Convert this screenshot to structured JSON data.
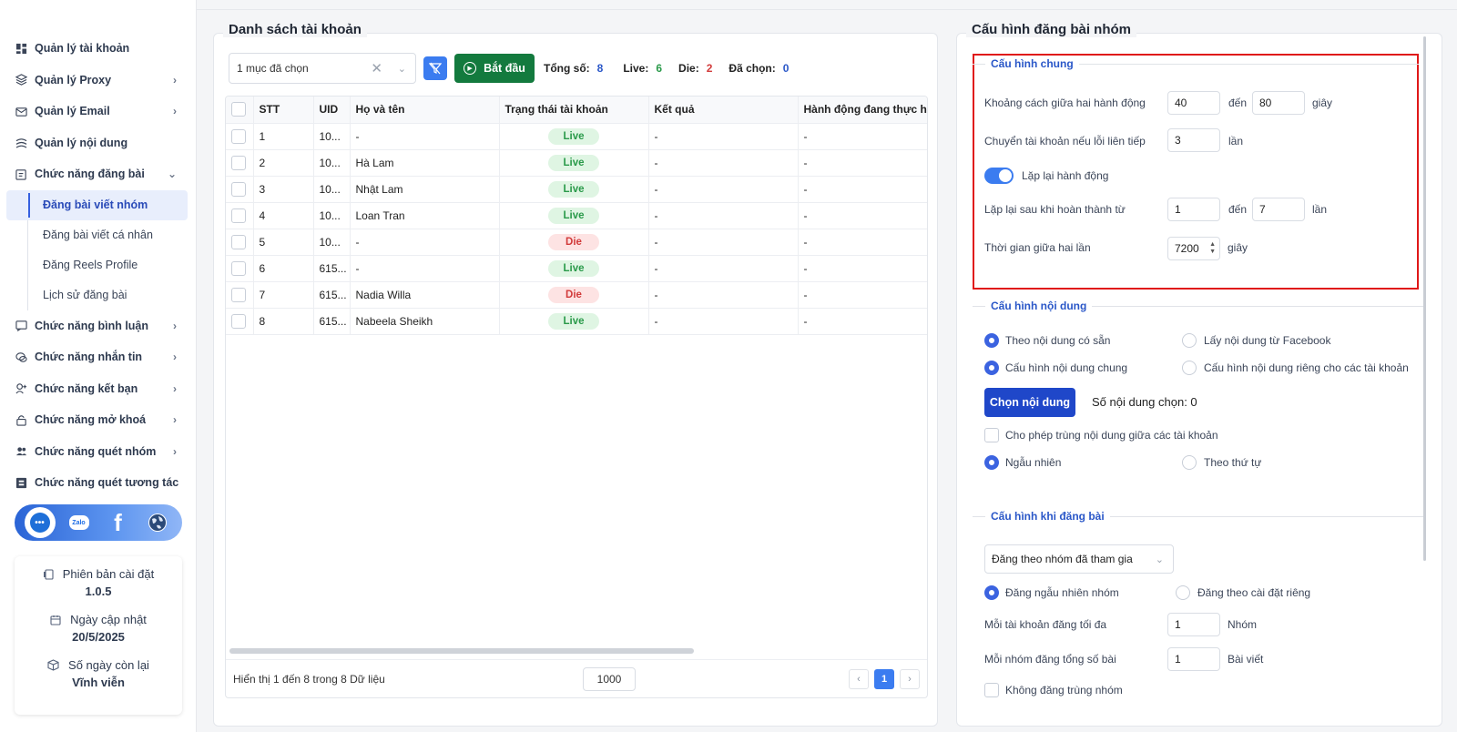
{
  "sidebar": {
    "items": [
      {
        "label": "Quản lý tài khoản",
        "icon": "dashboard-icon",
        "chevron": ""
      },
      {
        "label": "Quản lý Proxy",
        "icon": "layers-icon",
        "chevron": "›"
      },
      {
        "label": "Quản lý Email",
        "icon": "mail-icon",
        "chevron": "›"
      },
      {
        "label": "Quản lý nội dung",
        "icon": "content-icon",
        "chevron": ""
      },
      {
        "label": "Chức năng đăng bài",
        "icon": "post-icon",
        "chevron": "⌄"
      }
    ],
    "sub_items": [
      {
        "label": "Đăng bài viết nhóm",
        "active": true
      },
      {
        "label": "Đăng bài viết cá nhân",
        "active": false
      },
      {
        "label": "Đăng Reels Profile",
        "active": false
      },
      {
        "label": "Lịch sử đăng bài",
        "active": false
      }
    ],
    "items2": [
      {
        "label": "Chức năng bình luận",
        "icon": "comment-icon",
        "chevron": "›"
      },
      {
        "label": "Chức năng nhắn tin",
        "icon": "chat-icon",
        "chevron": "›"
      },
      {
        "label": "Chức năng kết bạn",
        "icon": "add-friend-icon",
        "chevron": "›"
      },
      {
        "label": "Chức năng mở khoá",
        "icon": "lock-icon",
        "chevron": "›"
      },
      {
        "label": "Chức năng quét nhóm",
        "icon": "group-icon",
        "chevron": "›"
      },
      {
        "label": "Chức năng quét tương tác",
        "icon": "scan-icon",
        "chevron": ""
      }
    ],
    "social": {
      "zalo": "Zalo",
      "facebook": "f"
    },
    "info": {
      "version_label": "Phiên bản cài đặt",
      "version": "1.0.5",
      "updated_label": "Ngày cập nhật",
      "updated": "20/5/2025",
      "days_label": "Số ngày còn lại",
      "days": "Vĩnh viễn"
    }
  },
  "left": {
    "title": "Danh sách tài khoản",
    "select_value": "1 mục đã chọn",
    "start_label": "Bắt đầu",
    "stats": {
      "total_label": "Tổng số:",
      "total": "8",
      "live_label": "Live:",
      "live": "6",
      "die_label": "Die:",
      "die": "2",
      "selected_label": "Đã chọn:",
      "selected": "0"
    },
    "colors": {
      "total": "#2a57c8",
      "live": "#2a9a4a",
      "die": "#d23b3b",
      "selected": "#2a57c8"
    },
    "columns": [
      "STT",
      "UID",
      "Họ và tên",
      "Trạng thái tài khoản",
      "Kết quả",
      "Hành động đang thực hiện"
    ],
    "rows": [
      {
        "stt": "1",
        "uid": "10...",
        "name": "-",
        "status": "Live",
        "result": "-",
        "action": "-"
      },
      {
        "stt": "2",
        "uid": "10...",
        "name": "Hà Lam",
        "status": "Live",
        "result": "-",
        "action": "-"
      },
      {
        "stt": "3",
        "uid": "10...",
        "name": "Nhật Lam",
        "status": "Live",
        "result": "-",
        "action": "-"
      },
      {
        "stt": "4",
        "uid": "10...",
        "name": "Loan Tran",
        "status": "Live",
        "result": "-",
        "action": "-"
      },
      {
        "stt": "5",
        "uid": "10...",
        "name": "-",
        "status": "Die",
        "result": "-",
        "action": "-"
      },
      {
        "stt": "6",
        "uid": "615...",
        "name": "-",
        "status": "Live",
        "result": "-",
        "action": "-"
      },
      {
        "stt": "7",
        "uid": "615...",
        "name": "Nadia Willa",
        "status": "Die",
        "result": "-",
        "action": "-"
      },
      {
        "stt": "8",
        "uid": "615...",
        "name": "Nabeela Sheikh",
        "status": "Live",
        "result": "-",
        "action": "-"
      }
    ],
    "footer_text": "Hiển thị 1 đến 8 trong 8 Dữ liệu",
    "page_size": "1000",
    "page_prev": "‹",
    "page_current": "1",
    "page_next": "›"
  },
  "right": {
    "title": "Cấu hình đăng bài nhóm",
    "general": {
      "title": "Cấu hình chung",
      "delay_label": "Khoảng cách giữa hai hành động",
      "delay_from": "40",
      "to_label": "đến",
      "delay_to": "80",
      "delay_unit": "giây",
      "switch_label": "Chuyển tài khoản nếu lỗi liên tiếp",
      "switch_value": "3",
      "switch_unit": "lần",
      "repeat_toggle_label": "Lặp lại hành động",
      "repeat_after_label": "Lặp lại sau khi hoàn thành từ",
      "repeat_from": "1",
      "repeat_to_label": "đến",
      "repeat_to": "7",
      "repeat_unit": "lần",
      "interval_label": "Thời gian giữa hai lần",
      "interval_value": "7200",
      "interval_unit": "giây"
    },
    "content": {
      "title": "Cấu hình nội dung",
      "opt_available": "Theo nội dung có sẵn",
      "opt_facebook": "Lấy nội dung từ Facebook",
      "opt_common": "Cấu hình nội dung chung",
      "opt_separate": "Cấu hình nội dung riêng cho các tài khoản",
      "choose_btn": "Chọn nội dung",
      "count_label": "Số nội dung chọn: 0",
      "allow_dup": "Cho phép trùng nội dung giữa các tài khoản",
      "random": "Ngẫu nhiên",
      "ordered": "Theo thứ tự"
    },
    "posting": {
      "title": "Cấu hình khi đăng bài",
      "select_value": "Đăng theo nhóm đã tham gia",
      "random_group": "Đăng ngẫu nhiên nhóm",
      "custom": "Đăng theo cài đặt riêng",
      "max_label": "Mỗi tài khoản đăng tối đa",
      "max_value": "1",
      "max_unit": "Nhóm",
      "per_group_label": "Mỗi nhóm đăng tổng số bài",
      "per_group_value": "1",
      "per_group_unit": "Bài viết",
      "no_dup_group": "Không đăng trùng nhóm"
    }
  }
}
